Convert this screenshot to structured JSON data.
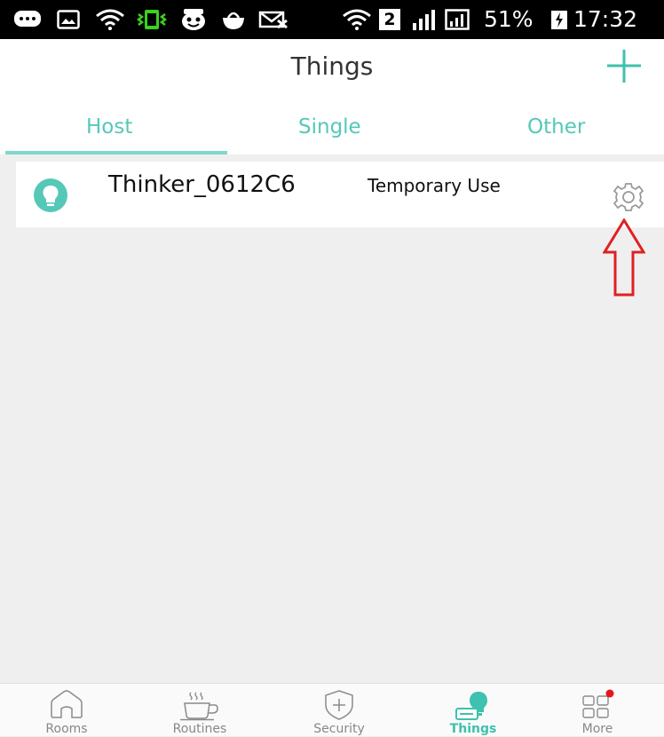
{
  "status_bar": {
    "battery_percent": "51%",
    "time": "17:32",
    "sim_badge": "2"
  },
  "header": {
    "title": "Things",
    "add_icon": "plus-icon"
  },
  "tabs": [
    {
      "label": "Host",
      "active": true
    },
    {
      "label": "Single",
      "active": false
    },
    {
      "label": "Other",
      "active": false
    }
  ],
  "devices": [
    {
      "name": "Thinker_0612C6",
      "status": "Temporary Use",
      "icon": "bulb-icon",
      "settings_icon": "gear-icon"
    }
  ],
  "bottom_nav": [
    {
      "label": "Rooms",
      "icon": "house-icon",
      "active": false
    },
    {
      "label": "Routines",
      "icon": "coffee-cup-icon",
      "active": false
    },
    {
      "label": "Security",
      "icon": "shield-icon",
      "active": false
    },
    {
      "label": "Things",
      "icon": "things-icon",
      "active": true
    },
    {
      "label": "More",
      "icon": "grid-icon",
      "active": false,
      "badge": true
    }
  ],
  "colors": {
    "accent": "#55c8b8",
    "active_nav": "#3ec1ae",
    "annotation": "#e02020",
    "badge": "#e8141f"
  }
}
